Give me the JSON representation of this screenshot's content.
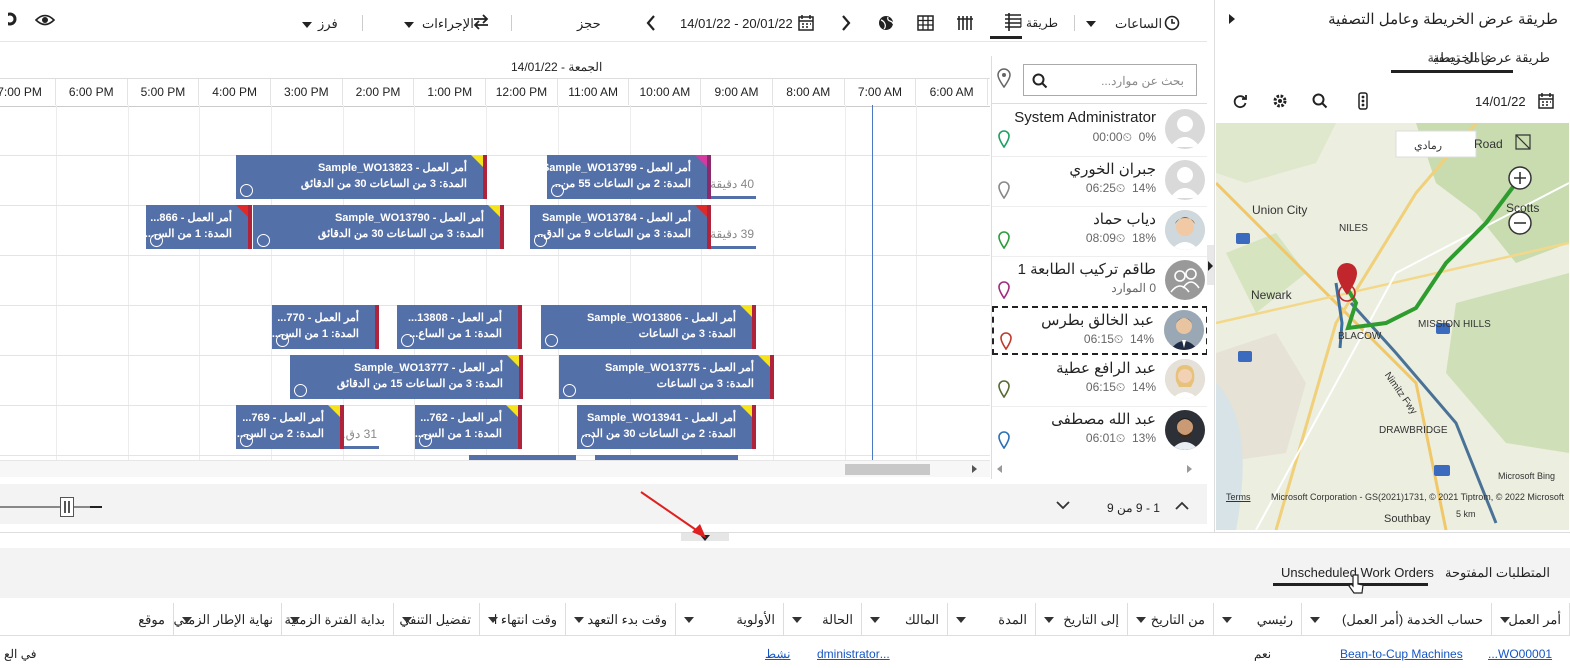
{
  "toolbar": {
    "hours_label": "الساعات",
    "view_label": "طريقة العرض",
    "date_range": "14/01/22 - 20/01/22",
    "booking_label": "حجز",
    "actions_label": "الإجراءات",
    "sort_label": "فرز"
  },
  "gantt": {
    "day_header": "الجمعة - 14/01/22",
    "hours": [
      "6:00 AM",
      "7:00 AM",
      "8:00 AM",
      "9:00 AM",
      "10:00 AM",
      "11:00 AM",
      "12:00 PM",
      "1:00 PM",
      "2:00 PM",
      "3:00 PM",
      "4:00 PM",
      "5:00 PM",
      "6:00 PM",
      "7:00 PM"
    ],
    "travel": [
      "40 دقيقة",
      "39 دقيقة",
      "31 دق..."
    ],
    "bookings": [
      {
        "title": "أمر العمل - Sample_WO13799...",
        "duration": "المدة: 2 من الساعات 55 من..."
      },
      {
        "title": "أمر العمل - Sample_WO13823",
        "duration": "المدة: 3 من الساعات 30 من الدقائق"
      },
      {
        "title": "أمر العمل - Sample_WO13784",
        "duration": "المدة: 3 من الساعات 9 من الدق..."
      },
      {
        "title": "أمر العمل - Sample_WO13790",
        "duration": "المدة: 3 من الساعات 30 من الدقائق"
      },
      {
        "title": "أمر العمل - 866...",
        "duration": "المدة: 1 من الس..."
      },
      {
        "title": "أمر العمل - Sample_WO13806",
        "duration": "المدة: 3 من الساعات"
      },
      {
        "title": "أمر العمل - 13808...",
        "duration": "المدة: 1 من الساع..."
      },
      {
        "title": "أمر العمل - 770...",
        "duration": "المدة: 1 من الس..."
      },
      {
        "title": "أمر العمل - Sample_WO13775",
        "duration": "المدة: 3 من الساعات"
      },
      {
        "title": "أمر العمل - Sample_WO13777",
        "duration": "المدة: 3 من الساعات 15 من الدقائق"
      },
      {
        "title": "أمر العمل - Sample_WO13941",
        "duration": "المدة: 2 من الساعات 30 من الد..."
      },
      {
        "title": "أمر العمل - 762...",
        "duration": "المدة: 1 من الس..."
      },
      {
        "title": "أمر العمل - 769...",
        "duration": "المدة: 2 من الس..."
      }
    ]
  },
  "resources": {
    "search_placeholder": "بحث عن موارد...",
    "items": [
      {
        "name": "System Administrator",
        "util": "0%",
        "time": "00:00"
      },
      {
        "name": "جبران الخوري",
        "util": "14%",
        "time": "06:25"
      },
      {
        "name": "دياب حماد",
        "util": "18%",
        "time": "08:09"
      },
      {
        "name": "طاقم تركيب الطابعة 1",
        "util": "0 الموارد",
        "time": ""
      },
      {
        "name": "عبد الخالق بطرس",
        "util": "14%",
        "time": "06:15"
      },
      {
        "name": "عبد الرافع عطية",
        "util": "14%",
        "time": "06:15"
      },
      {
        "name": "عبد الله مصطفى",
        "util": "13%",
        "time": "06:01"
      }
    ],
    "pagination": "1 - 9 من 9"
  },
  "map": {
    "panel_title": "طريقة عرض الخريطة وعامل التصفية",
    "tab_map": "طريقة عرض الخريطة",
    "tab_filter": "عامل تصفية",
    "date": "14/01/22",
    "road": "Road",
    "gray": "رمادي",
    "labels": [
      "Union City",
      "NILES",
      "Newark",
      "Scotts",
      "MISSION HILLS",
      "BLACOW",
      "DRAWBRIDGE",
      "Nimitz Fwy",
      "Southbay",
      "Microsoft Bing"
    ],
    "copyright": "Microsoft Corporation - GS(2021)1731, © 2021 Tiptrom, © 2022 Microsoft Corporation",
    "terms": "Terms",
    "scale": "5 km"
  },
  "bottom": {
    "tabs": [
      "المتطلبات المفتوحة",
      "Unscheduled Work Orders"
    ],
    "columns": [
      "أمر العمل",
      "حساب الخدمة (أمر العمل)",
      "رئيسي",
      "من التاريخ",
      "إلى التاريخ",
      "المدة",
      "المالك",
      "الحالة",
      "الأولوية",
      "وقت بدء التعهد",
      "وقت انتهاء ا",
      "تفضيل التنفي",
      "بداية الفترة الزمنية",
      "نهاية الإطار الزمني",
      "موقع"
    ],
    "row": {
      "wo": "WO00001...",
      "account": "Bean-to-Cup Machines",
      "primary": "نعم",
      "owner": "...dministrator",
      "status": "نشط",
      "location": "في الع"
    }
  }
}
